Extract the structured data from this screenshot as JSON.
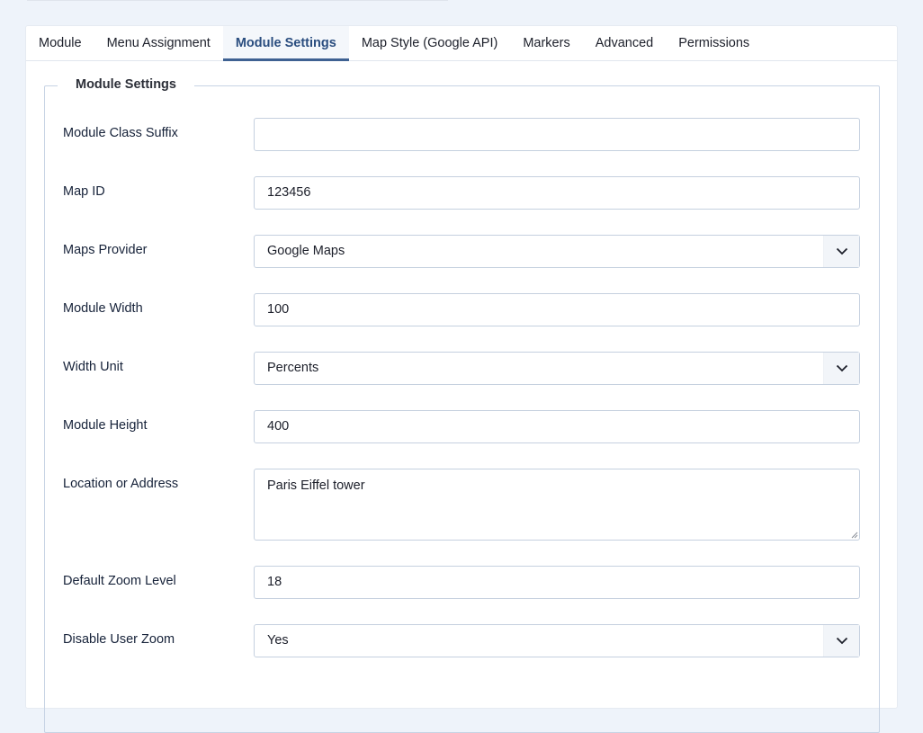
{
  "tabs": [
    {
      "label": "Module",
      "active": false
    },
    {
      "label": "Menu Assignment",
      "active": false
    },
    {
      "label": "Module Settings",
      "active": true
    },
    {
      "label": "Map Style (Google API)",
      "active": false
    },
    {
      "label": "Markers",
      "active": false
    },
    {
      "label": "Advanced",
      "active": false
    },
    {
      "label": "Permissions",
      "active": false
    }
  ],
  "fieldset": {
    "legend": "Module Settings",
    "fields": [
      {
        "label": "Module Class Suffix",
        "type": "text",
        "value": ""
      },
      {
        "label": "Map ID",
        "type": "text",
        "value": "123456"
      },
      {
        "label": "Maps Provider",
        "type": "select",
        "value": "Google Maps"
      },
      {
        "label": "Module Width",
        "type": "text",
        "value": "100"
      },
      {
        "label": "Width Unit",
        "type": "select",
        "value": "Percents"
      },
      {
        "label": "Module Height",
        "type": "text",
        "value": "400"
      },
      {
        "label": "Location or Address",
        "type": "textarea",
        "value": "Paris Eiffel tower"
      },
      {
        "label": "Default Zoom Level",
        "type": "text",
        "value": "18"
      },
      {
        "label": "Disable User Zoom",
        "type": "select",
        "value": "Yes"
      }
    ]
  },
  "colors": {
    "page_bg": "#eef3fa",
    "active_tab_text": "#2a4d7f",
    "active_tab_underline": "#3e6192",
    "input_border": "#c5d0df"
  }
}
